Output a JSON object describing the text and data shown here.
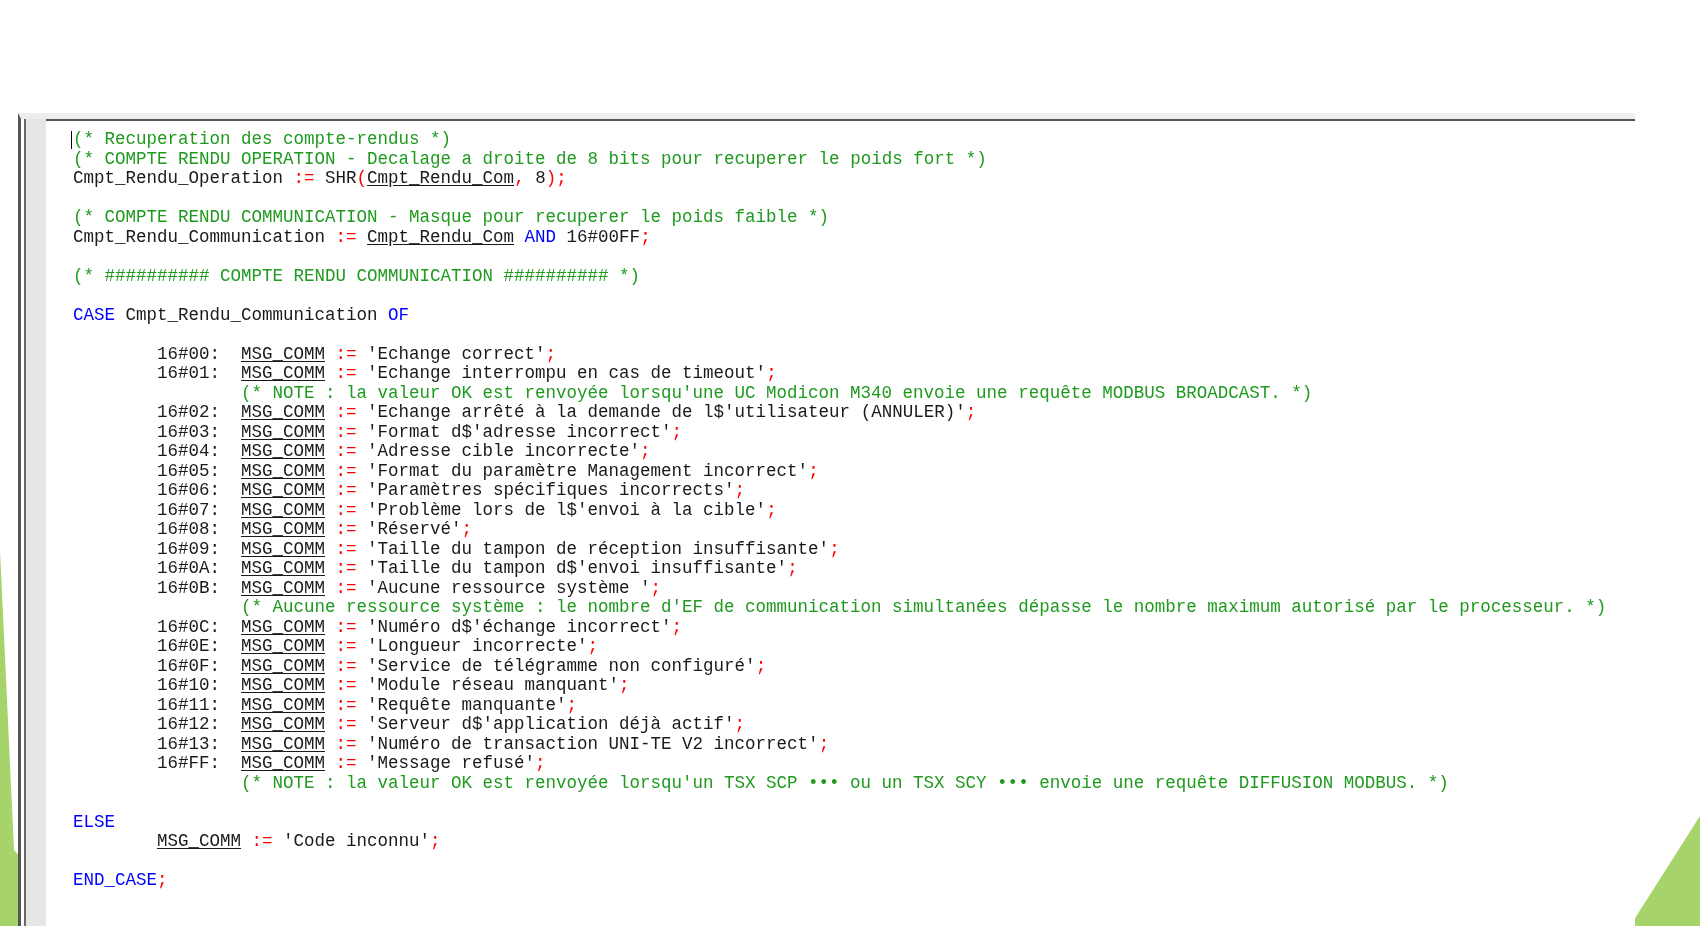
{
  "editor": {
    "lines": [
      {
        "kind": "top",
        "tokens": [
          {
            "kind": "comment",
            "t": "(* Recuperation des compte-rendus *)"
          }
        ]
      },
      {
        "kind": "top",
        "tokens": [
          {
            "kind": "comment",
            "t": "(* COMPTE RENDU OPERATION - Decalage a droite de 8 bits pour recuperer le poids fort *)"
          }
        ]
      },
      {
        "kind": "top",
        "tokens": [
          {
            "kind": "plain",
            "t": "Cmpt_Rendu_Operation "
          },
          {
            "kind": "op",
            "t": ":="
          },
          {
            "kind": "plain",
            "t": " SHR"
          },
          {
            "kind": "op",
            "t": "("
          },
          {
            "kind": "var",
            "t": "Cmpt_Rendu_Com"
          },
          {
            "kind": "op",
            "t": ","
          },
          {
            "kind": "plain",
            "t": " 8"
          },
          {
            "kind": "op",
            "t": ");"
          }
        ]
      },
      {
        "kind": "blank"
      },
      {
        "kind": "top",
        "tokens": [
          {
            "kind": "comment",
            "t": "(* COMPTE RENDU COMMUNICATION - Masque pour recuperer le poids faible *)"
          }
        ]
      },
      {
        "kind": "top",
        "tokens": [
          {
            "kind": "plain",
            "t": "Cmpt_Rendu_Communication "
          },
          {
            "kind": "op",
            "t": ":= "
          },
          {
            "kind": "var",
            "t": "Cmpt_Rendu_Com"
          },
          {
            "kind": "keyword",
            "t": " AND"
          },
          {
            "kind": "plain",
            "t": " 16#00FF"
          },
          {
            "kind": "op",
            "t": ";"
          }
        ]
      },
      {
        "kind": "blank"
      },
      {
        "kind": "top",
        "tokens": [
          {
            "kind": "comment",
            "t": "(* ########## COMPTE RENDU COMMUNICATION ########## *)"
          }
        ]
      },
      {
        "kind": "blank"
      },
      {
        "kind": "top",
        "tokens": [
          {
            "kind": "keyword",
            "t": "CASE"
          },
          {
            "kind": "plain",
            "t": " Cmpt_Rendu_Communication "
          },
          {
            "kind": "keyword",
            "t": "OF"
          }
        ]
      },
      {
        "kind": "blank"
      },
      {
        "kind": "arm",
        "tokens": [
          {
            "kind": "plain",
            "t": "16#00:  "
          },
          {
            "kind": "var",
            "t": "MSG_COMM"
          },
          {
            "kind": "op",
            "t": " := "
          },
          {
            "kind": "plain",
            "t": "'Echange correct'"
          },
          {
            "kind": "op",
            "t": ";"
          }
        ]
      },
      {
        "kind": "arm",
        "tokens": [
          {
            "kind": "plain",
            "t": "16#01:  "
          },
          {
            "kind": "var",
            "t": "MSG_COMM"
          },
          {
            "kind": "op",
            "t": " := "
          },
          {
            "kind": "plain",
            "t": "'Echange interrompu en cas de timeout'"
          },
          {
            "kind": "op",
            "t": ";"
          }
        ]
      },
      {
        "kind": "note",
        "tokens": [
          {
            "kind": "comment",
            "t": "(* NOTE : la valeur OK est renvoyée lorsqu'une UC Modicon M340 envoie une requête MODBUS BROADCAST. *)"
          }
        ]
      },
      {
        "kind": "arm",
        "tokens": [
          {
            "kind": "plain",
            "t": "16#02:  "
          },
          {
            "kind": "var",
            "t": "MSG_COMM"
          },
          {
            "kind": "op",
            "t": " := "
          },
          {
            "kind": "plain",
            "t": "'Echange arrêté à la demande de l$'utilisateur (ANNULER)'"
          },
          {
            "kind": "op",
            "t": ";"
          }
        ]
      },
      {
        "kind": "arm",
        "tokens": [
          {
            "kind": "plain",
            "t": "16#03:  "
          },
          {
            "kind": "var",
            "t": "MSG_COMM"
          },
          {
            "kind": "op",
            "t": " := "
          },
          {
            "kind": "plain",
            "t": "'Format d$'adresse incorrect'"
          },
          {
            "kind": "op",
            "t": ";"
          }
        ]
      },
      {
        "kind": "arm",
        "tokens": [
          {
            "kind": "plain",
            "t": "16#04:  "
          },
          {
            "kind": "var",
            "t": "MSG_COMM"
          },
          {
            "kind": "op",
            "t": " := "
          },
          {
            "kind": "plain",
            "t": "'Adresse cible incorrecte'"
          },
          {
            "kind": "op",
            "t": ";"
          }
        ]
      },
      {
        "kind": "arm",
        "tokens": [
          {
            "kind": "plain",
            "t": "16#05:  "
          },
          {
            "kind": "var",
            "t": "MSG_COMM"
          },
          {
            "kind": "op",
            "t": " := "
          },
          {
            "kind": "plain",
            "t": "'Format du paramètre Management incorrect'"
          },
          {
            "kind": "op",
            "t": ";"
          }
        ]
      },
      {
        "kind": "arm",
        "tokens": [
          {
            "kind": "plain",
            "t": "16#06:  "
          },
          {
            "kind": "var",
            "t": "MSG_COMM"
          },
          {
            "kind": "op",
            "t": " := "
          },
          {
            "kind": "plain",
            "t": "'Paramètres spécifiques incorrects'"
          },
          {
            "kind": "op",
            "t": ";"
          }
        ]
      },
      {
        "kind": "arm",
        "tokens": [
          {
            "kind": "plain",
            "t": "16#07:  "
          },
          {
            "kind": "var",
            "t": "MSG_COMM"
          },
          {
            "kind": "op",
            "t": " := "
          },
          {
            "kind": "plain",
            "t": "'Problème lors de l$'envoi à la cible'"
          },
          {
            "kind": "op",
            "t": ";"
          }
        ]
      },
      {
        "kind": "arm",
        "tokens": [
          {
            "kind": "plain",
            "t": "16#08:  "
          },
          {
            "kind": "var",
            "t": "MSG_COMM"
          },
          {
            "kind": "op",
            "t": " := "
          },
          {
            "kind": "plain",
            "t": "'Réservé'"
          },
          {
            "kind": "op",
            "t": ";"
          }
        ]
      },
      {
        "kind": "arm",
        "tokens": [
          {
            "kind": "plain",
            "t": "16#09:  "
          },
          {
            "kind": "var",
            "t": "MSG_COMM"
          },
          {
            "kind": "op",
            "t": " := "
          },
          {
            "kind": "plain",
            "t": "'Taille du tampon de réception insuffisante'"
          },
          {
            "kind": "op",
            "t": ";"
          }
        ]
      },
      {
        "kind": "arm",
        "tokens": [
          {
            "kind": "plain",
            "t": "16#0A:  "
          },
          {
            "kind": "var",
            "t": "MSG_COMM"
          },
          {
            "kind": "op",
            "t": " := "
          },
          {
            "kind": "plain",
            "t": "'Taille du tampon d$'envoi insuffisante'"
          },
          {
            "kind": "op",
            "t": ";"
          }
        ]
      },
      {
        "kind": "arm",
        "tokens": [
          {
            "kind": "plain",
            "t": "16#0B:  "
          },
          {
            "kind": "var",
            "t": "MSG_COMM"
          },
          {
            "kind": "op",
            "t": " := "
          },
          {
            "kind": "plain",
            "t": "'Aucune ressource système '"
          },
          {
            "kind": "op",
            "t": ";"
          }
        ]
      },
      {
        "kind": "note",
        "tokens": [
          {
            "kind": "comment",
            "t": "(* Aucune ressource système : le nombre d'EF de communication simultanées dépasse le nombre maximum autorisé par le processeur. *)"
          }
        ]
      },
      {
        "kind": "arm",
        "tokens": [
          {
            "kind": "plain",
            "t": "16#0C:  "
          },
          {
            "kind": "var",
            "t": "MSG_COMM"
          },
          {
            "kind": "op",
            "t": " := "
          },
          {
            "kind": "plain",
            "t": "'Numéro d$'échange incorrect'"
          },
          {
            "kind": "op",
            "t": ";"
          }
        ]
      },
      {
        "kind": "arm",
        "tokens": [
          {
            "kind": "plain",
            "t": "16#0E:  "
          },
          {
            "kind": "var",
            "t": "MSG_COMM"
          },
          {
            "kind": "op",
            "t": " := "
          },
          {
            "kind": "plain",
            "t": "'Longueur incorrecte'"
          },
          {
            "kind": "op",
            "t": ";"
          }
        ]
      },
      {
        "kind": "arm",
        "tokens": [
          {
            "kind": "plain",
            "t": "16#0F:  "
          },
          {
            "kind": "var",
            "t": "MSG_COMM"
          },
          {
            "kind": "op",
            "t": " := "
          },
          {
            "kind": "plain",
            "t": "'Service de télégramme non configuré'"
          },
          {
            "kind": "op",
            "t": ";"
          }
        ]
      },
      {
        "kind": "arm",
        "tokens": [
          {
            "kind": "plain",
            "t": "16#10:  "
          },
          {
            "kind": "var",
            "t": "MSG_COMM"
          },
          {
            "kind": "op",
            "t": " := "
          },
          {
            "kind": "plain",
            "t": "'Module réseau manquant'"
          },
          {
            "kind": "op",
            "t": ";"
          }
        ]
      },
      {
        "kind": "arm",
        "tokens": [
          {
            "kind": "plain",
            "t": "16#11:  "
          },
          {
            "kind": "var",
            "t": "MSG_COMM"
          },
          {
            "kind": "op",
            "t": " := "
          },
          {
            "kind": "plain",
            "t": "'Requête manquante'"
          },
          {
            "kind": "op",
            "t": ";"
          }
        ]
      },
      {
        "kind": "arm",
        "tokens": [
          {
            "kind": "plain",
            "t": "16#12:  "
          },
          {
            "kind": "var",
            "t": "MSG_COMM"
          },
          {
            "kind": "op",
            "t": " := "
          },
          {
            "kind": "plain",
            "t": "'Serveur d$'application déjà actif'"
          },
          {
            "kind": "op",
            "t": ";"
          }
        ]
      },
      {
        "kind": "arm",
        "tokens": [
          {
            "kind": "plain",
            "t": "16#13:  "
          },
          {
            "kind": "var",
            "t": "MSG_COMM"
          },
          {
            "kind": "op",
            "t": " := "
          },
          {
            "kind": "plain",
            "t": "'Numéro de transaction UNI-TE V2 incorrect'"
          },
          {
            "kind": "op",
            "t": ";"
          }
        ]
      },
      {
        "kind": "arm",
        "tokens": [
          {
            "kind": "plain",
            "t": "16#FF:  "
          },
          {
            "kind": "var",
            "t": "MSG_COMM"
          },
          {
            "kind": "op",
            "t": " := "
          },
          {
            "kind": "plain",
            "t": "'Message refusé'"
          },
          {
            "kind": "op",
            "t": ";"
          }
        ]
      },
      {
        "kind": "note",
        "tokens": [
          {
            "kind": "comment",
            "t": "(* NOTE : la valeur OK est renvoyée lorsqu'un TSX SCP ••• ou un TSX SCY ••• envoie une requête DIFFUSION MODBUS. *)"
          }
        ]
      },
      {
        "kind": "blank"
      },
      {
        "kind": "top",
        "tokens": [
          {
            "kind": "keyword",
            "t": "ELSE"
          }
        ]
      },
      {
        "kind": "arm",
        "tokens": [
          {
            "kind": "var",
            "t": "MSG_COMM"
          },
          {
            "kind": "op",
            "t": " := "
          },
          {
            "kind": "plain",
            "t": "'Code inconnu'"
          },
          {
            "kind": "op",
            "t": ";"
          }
        ]
      },
      {
        "kind": "blank"
      },
      {
        "kind": "top",
        "tokens": [
          {
            "kind": "keyword",
            "t": "END_CASE"
          },
          {
            "kind": "op",
            "t": ";"
          }
        ]
      }
    ]
  }
}
